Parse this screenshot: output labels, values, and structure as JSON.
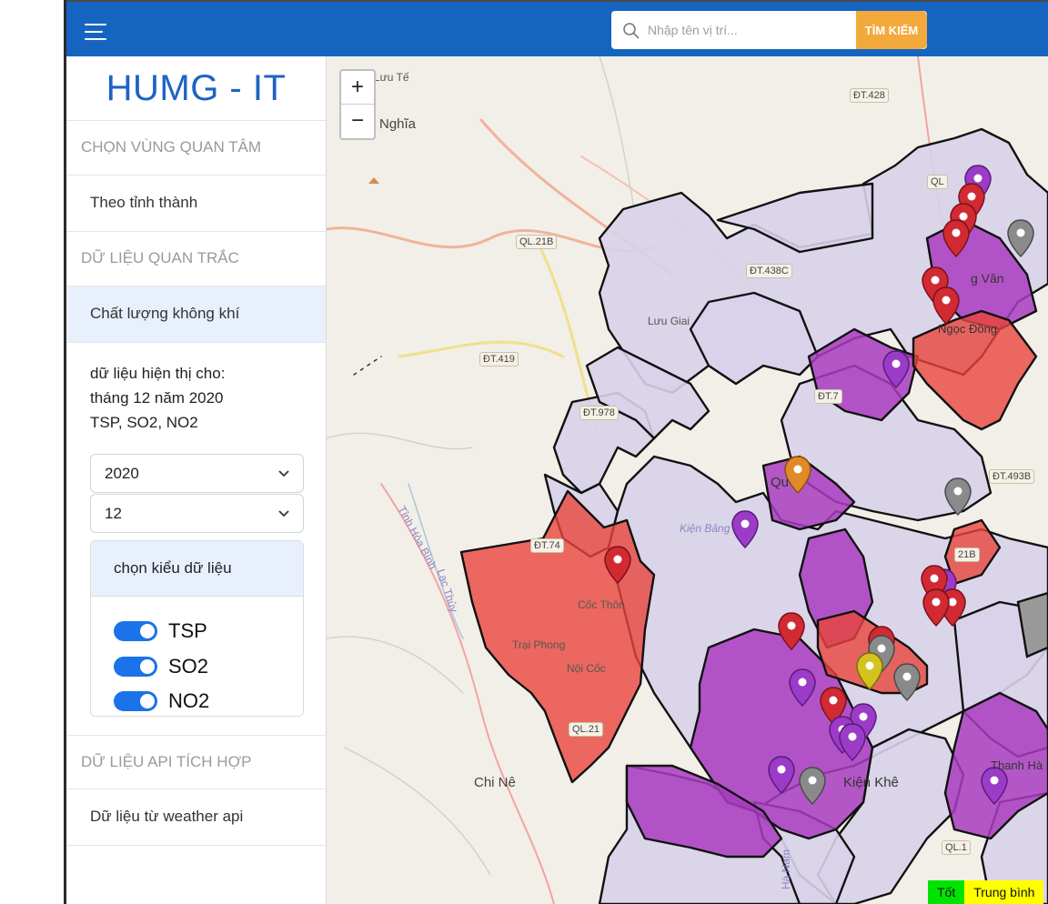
{
  "header": {
    "search_placeholder": "Nhập tên vị trí...",
    "search_button": "TÌM KIẾM"
  },
  "sidebar": {
    "brand": "HUMG - IT",
    "section_region": "CHỌN VÙNG QUAN TÂM",
    "item_province": "Theo tỉnh thành",
    "section_monitoring": "DỮ LIỆU QUAN TRẮC",
    "item_air_quality": "Chất lượng không khí",
    "info_line1": "dữ liệu hiện thị cho:",
    "info_line2": "tháng 12 năm 2020",
    "info_line3": "TSP, SO2, NO2",
    "year_value": "2020",
    "month_value": "12",
    "data_type_title": "chọn kiểu dữ liệu",
    "toggles": [
      {
        "label": "TSP",
        "on": true
      },
      {
        "label": "SO2",
        "on": true
      },
      {
        "label": "NO2",
        "on": true
      }
    ],
    "section_api": "DỮ LIỆU API TÍCH HỢP",
    "item_weather_api": "Dữ liệu từ weather api"
  },
  "map": {
    "zoom_in": "+",
    "zoom_out": "−",
    "labels": {
      "luu_te": "Lưu Tế",
      "nghia": "Nghĩa",
      "luu_giai": "Lưu Giai",
      "coc_thon": "Cốc Thôn",
      "trai_phong": "Trại Phong",
      "noi_coc": "Nội Cốc",
      "chi_ne": "Chi Nê",
      "tinh_hoa_binh": "Tỉnh Hòa Bình",
      "lac_thuy": "Lạc Thủy",
      "kien_khe": "Kiện Khê",
      "qu": "Qu",
      "kien_bang": "Kiện Bảng",
      "g_van": "g Văn",
      "ngoc_dong": "Ngọc Đồng",
      "thanh_ha": "Thanh Hà",
      "ha_nam": "Hà Nam"
    },
    "roads": {
      "ql21b_top": "QL.21B",
      "dt419": "ĐT.419",
      "dt978": "ĐT.978",
      "dt428": "ĐT.428",
      "dt438c": "ĐT.438C",
      "dt7": "ĐT.7",
      "dt493b": "ĐT.493B",
      "dt74": "ĐT.74",
      "ql21": "QL.21",
      "ql1": "QL.1",
      "ql_top": "QL",
      "ql21b_mid": "21B"
    },
    "legend": [
      {
        "label": "Tốt",
        "color": "#00e400"
      },
      {
        "label": "Trung bình",
        "color": "#ffff00"
      }
    ]
  },
  "colors": {
    "header": "#1565c0",
    "accent": "#f4a93c",
    "brand": "#1e62c5",
    "zone_light": "#d8d2ea",
    "zone_purple": "#a93cbf",
    "zone_red": "#e8453c"
  }
}
